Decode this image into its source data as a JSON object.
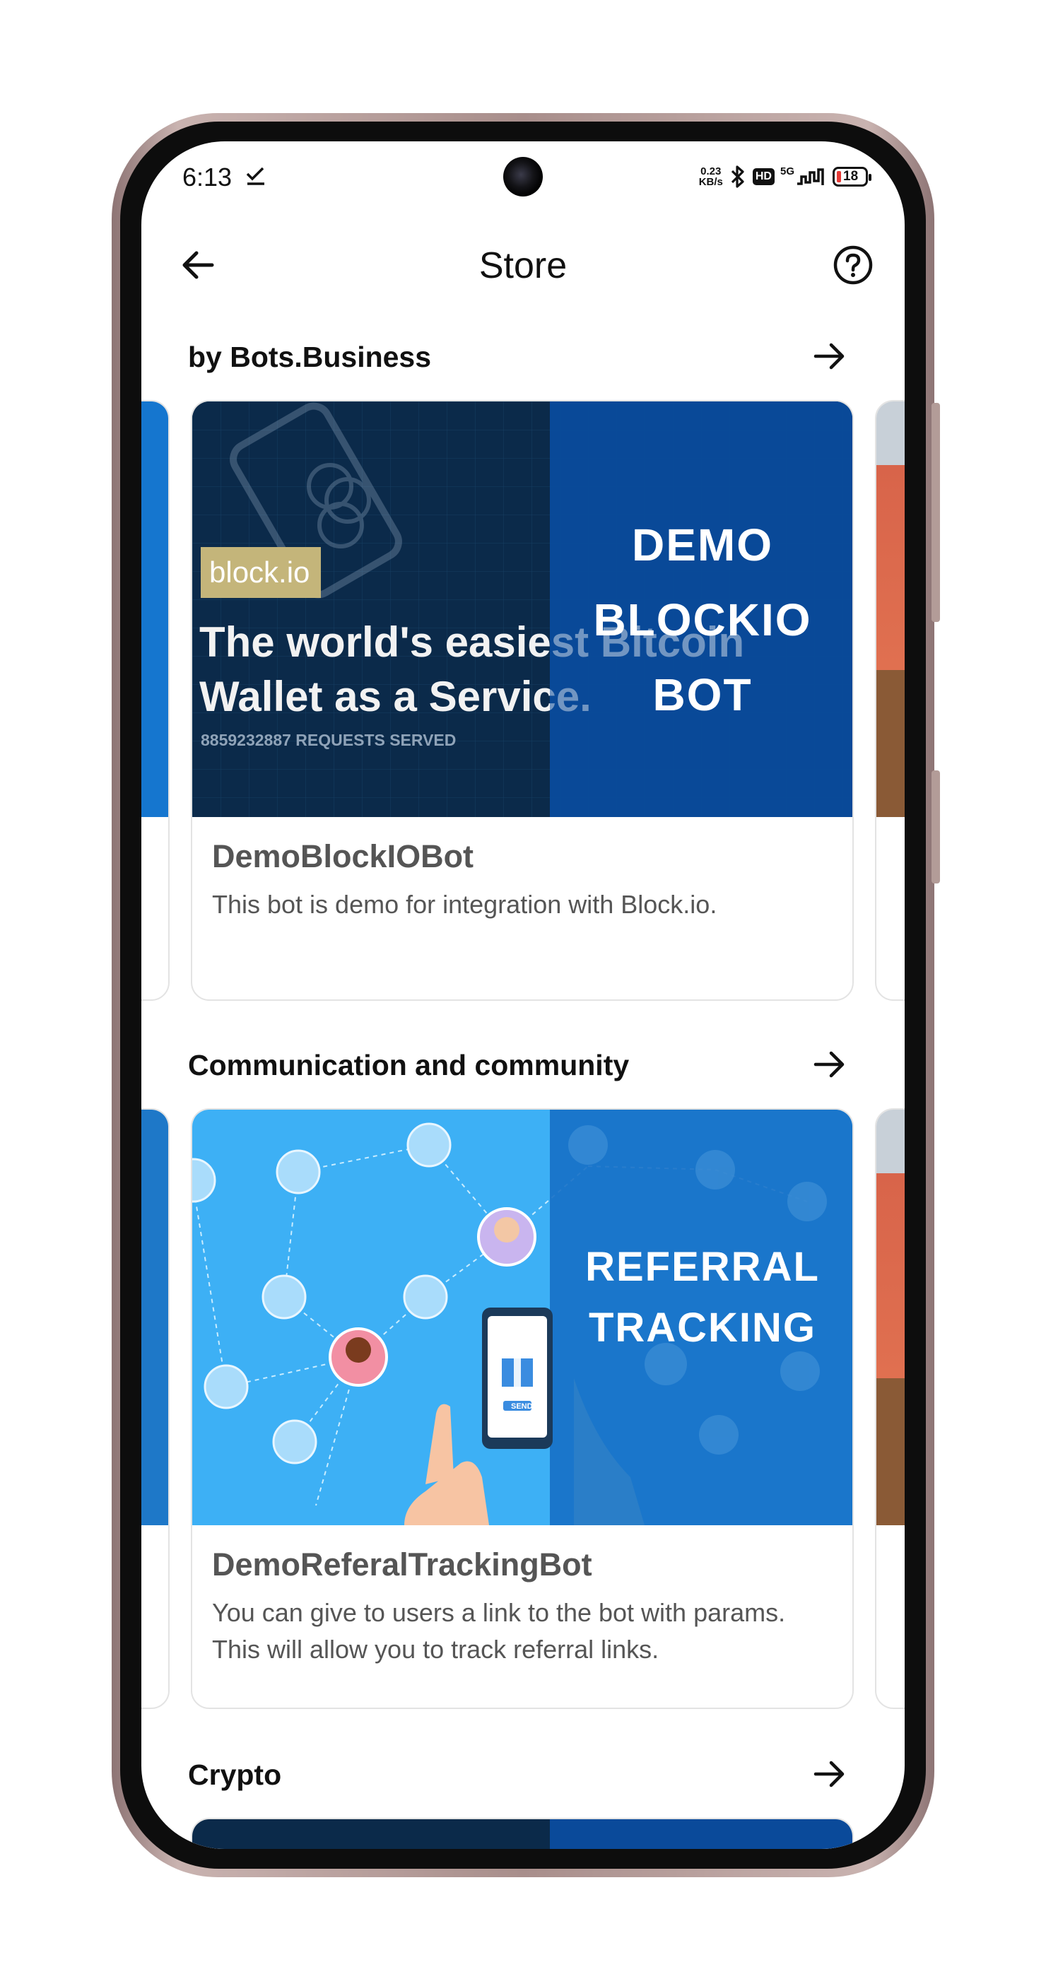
{
  "status_bar": {
    "time": "6:13",
    "net_speed_value": "0.23",
    "net_speed_unit": "KB/s",
    "hd": "HD",
    "network": "5G",
    "battery": "18"
  },
  "header": {
    "title": "Store"
  },
  "sections": [
    {
      "title": "by Bots.Business",
      "card": {
        "name": "DemoBlockIOBot",
        "description": "This bot is demo for integration with Block.io.",
        "image": {
          "brand": "block.io",
          "headline_1": "The world's easiest Bitcoin",
          "headline_2": "Wallet as a Service.",
          "requests": "8859232887 REQUESTS SERVED",
          "overlay_1": "DEMO",
          "overlay_2": "BLOCKIO",
          "overlay_3": "BOT"
        }
      }
    },
    {
      "title": "Communication and community",
      "card": {
        "name": "DemoReferalTrackingBot",
        "description": "You can give to users a link to the bot with params. This will allow you to track referral links.",
        "image": {
          "overlay_1": "REFERRAL",
          "overlay_2": "TRACKING",
          "send_label": "SEND"
        }
      }
    },
    {
      "title": "Crypto"
    }
  ],
  "colors": {
    "blockio_bg": "#0b2a4a",
    "blockio_overlay": "#0a4a9a",
    "referral_bg": "#3db0f5",
    "referral_overlay": "#1670c6",
    "brand_badge": "#c4b57a"
  }
}
